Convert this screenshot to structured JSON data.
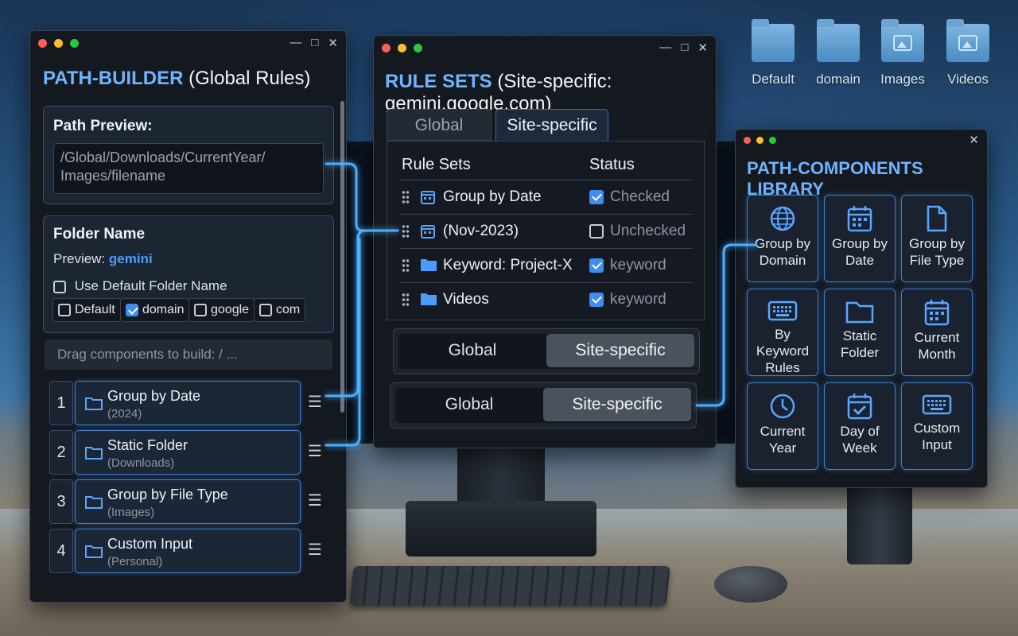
{
  "desktop": {
    "folders": [
      {
        "label": "Default",
        "icon": "folder-icon"
      },
      {
        "label": "domain",
        "icon": "folder-icon"
      },
      {
        "label": "Images",
        "icon": "image-folder-icon"
      },
      {
        "label": "Videos",
        "icon": "image-folder-icon"
      }
    ]
  },
  "path_builder": {
    "title_bold": "PATH-BUILDER",
    "title_rest": "(Global Rules)",
    "path_preview": {
      "heading": "Path Preview:",
      "value_line1": "/Global/Downloads/CurrentYear/",
      "value_line2": "Images/filename"
    },
    "folder_name": {
      "heading": "Folder Name",
      "preview_label": "Preview:",
      "preview_value": "gemini",
      "use_default_label": "Use Default Folder Name",
      "use_default_checked": false,
      "chips": [
        {
          "label": "Default",
          "checked": false
        },
        {
          "label": "domain",
          "checked": true
        },
        {
          "label": "google",
          "checked": false
        },
        {
          "label": "com",
          "checked": false
        }
      ]
    },
    "drag_hint": "Drag components to build: / ...",
    "components": [
      {
        "num": "1",
        "name": "Group by Date",
        "detail": "(2024)"
      },
      {
        "num": "2",
        "name": "Static Folder",
        "detail": "(Downloads)"
      },
      {
        "num": "3",
        "name": "Group by File Type",
        "detail": "(Images)"
      },
      {
        "num": "4",
        "name": "Custom Input",
        "detail": "(Personal)"
      }
    ],
    "handle_glyph": "☰"
  },
  "rule_sets": {
    "title_bold": "RULE SETS",
    "title_rest": "(Site-specific: gemini.google.com)",
    "tabs": [
      "Global",
      "Site-specific"
    ],
    "active_tab": "Site-specific",
    "col_rule_sets": "Rule Sets",
    "col_status": "Status",
    "rows": [
      {
        "name": "Group by Date",
        "icon": "calendar-icon",
        "status": "Checked",
        "checked": true
      },
      {
        "name": "(Nov-2023)",
        "icon": "calendar-icon",
        "status": "Unchecked",
        "checked": false
      },
      {
        "name": "Keyword: Project-X",
        "icon": "folder-icon",
        "status": "keyword",
        "checked": true
      },
      {
        "name": "Videos",
        "icon": "folder-icon",
        "status": "keyword",
        "checked": true
      }
    ],
    "toggle1": {
      "options": [
        "Global",
        "Site-specific"
      ],
      "selected": "Site-specific"
    },
    "toggle2": {
      "options": [
        "Global",
        "Site-specific"
      ],
      "selected": "Site-specific"
    }
  },
  "library": {
    "title": "PATH-COMPONENTS LIBRARY",
    "items": [
      {
        "label": "Group by\nDomain",
        "icon": "globe-icon"
      },
      {
        "label": "Group by\nDate",
        "icon": "calendar-icon"
      },
      {
        "label": "Group by\nFile Type",
        "icon": "file-icon"
      },
      {
        "label": "By Keyword\nRules",
        "icon": "keyboard-icon"
      },
      {
        "label": "Static\nFolder",
        "icon": "folder-icon"
      },
      {
        "label": "Current\nMonth",
        "icon": "calendar-icon"
      },
      {
        "label": "Current\nYear",
        "icon": "clock-icon"
      },
      {
        "label": "Day of\nWeek",
        "icon": "calendar-check-icon"
      },
      {
        "label": "Custom\nInput",
        "icon": "keyboard-icon"
      }
    ]
  },
  "colors": {
    "accent": "#3d8ef0",
    "accent_light": "#6fb4ff",
    "connector": "#4ab0ff"
  }
}
